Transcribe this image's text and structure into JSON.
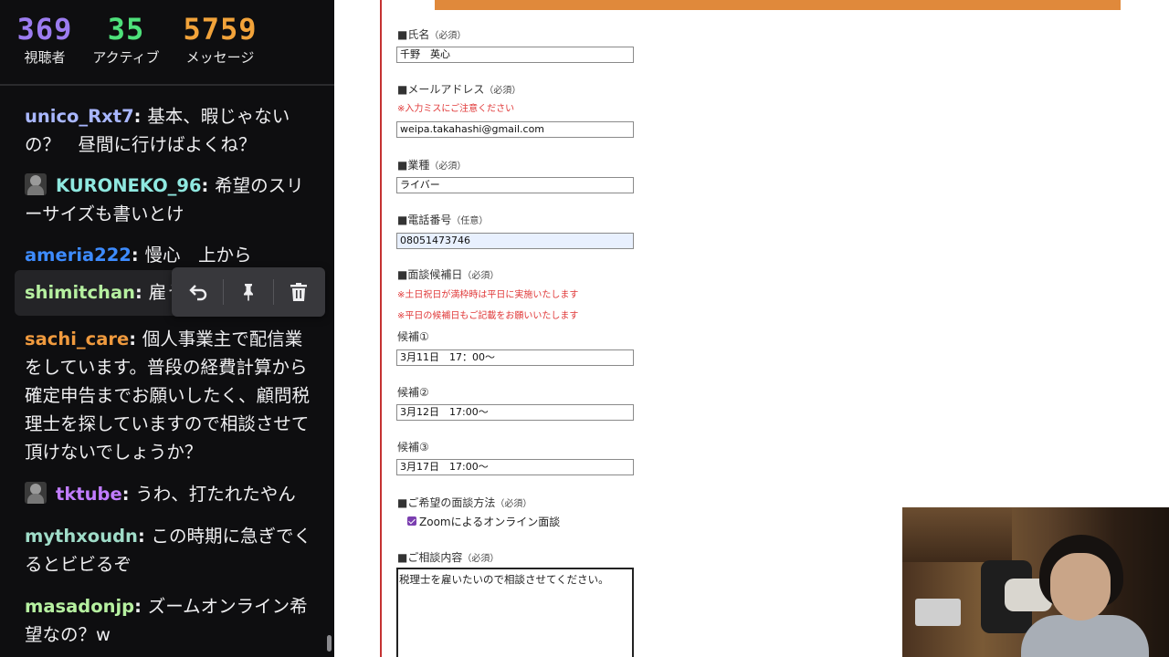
{
  "stats": {
    "viewers": {
      "value": "369",
      "label": "視聴者",
      "color": "#9c7cf0"
    },
    "active": {
      "value": "35",
      "label": "アクティブ",
      "color": "#4ee07a"
    },
    "messages": {
      "value": "5759",
      "label": "メッセージ",
      "color": "#f2a33a"
    }
  },
  "chat": {
    "messages": [
      {
        "user": "unico_Rxt7",
        "text": "基本、暇じゃないの？　昼間に行けばよくね？",
        "color": "#a9b7ff",
        "avatar": false
      },
      {
        "user": "KURONEKO_96",
        "text": "希望のスリーサイズも書いとけ",
        "color": "#8fe8e0",
        "avatar": true
      },
      {
        "user": "ameria222",
        "text": "慢心　上から",
        "color": "#3d8bff",
        "avatar": false
      },
      {
        "user": "shimitchan",
        "text": "雇うの",
        "color": "#b6f0a0",
        "avatar": false
      },
      {
        "user": "sachi_care",
        "text": "個人事業主で配信業をしています。普段の経費計算から確定申告までお願いしたく、顧問税理士を探していますので相談させて頂けないでしょうか？",
        "color": "#f09a3e",
        "avatar": false
      },
      {
        "user": "tktube",
        "text": "うわ、打たれたやん",
        "color": "#c17cff",
        "avatar": true
      },
      {
        "user": "mythxoudn",
        "text": "この時期に急ぎでくるとビビるぞ",
        "color": "#9fdcc8",
        "avatar": false
      },
      {
        "user": "masadonjp",
        "text": "ズームオンライン希望なの？w",
        "color": "#b6f0a0",
        "avatar": false
      }
    ],
    "toolbar_icons": [
      "reply-icon",
      "pin-icon",
      "trash-icon"
    ]
  },
  "form": {
    "name": {
      "label": "■氏名",
      "req": "（必須）",
      "value": "千野　英心"
    },
    "email": {
      "label": "■メールアドレス",
      "req": "（必須）",
      "note": "※入力ミスにご注意ください",
      "value": "weipa.takahashi@gmail.com"
    },
    "industry": {
      "label": "■業種",
      "req": "（必須）",
      "value": "ライバー"
    },
    "phone": {
      "label": "■電話番号",
      "req": "（任意）",
      "value": "08051473746"
    },
    "interview": {
      "label": "■面談候補日",
      "req": "（必須）",
      "notes": [
        "※土日祝日が満枠時は平日に実施いたします",
        "※平日の候補日もご記載をお願いいたします"
      ],
      "candidates": [
        {
          "label": "候補①",
          "value": "3月11日　17：00～"
        },
        {
          "label": "候補②",
          "value": "3月12日　17:00～"
        },
        {
          "label": "候補③",
          "value": "3月17日　17:00～"
        }
      ]
    },
    "method": {
      "label": "■ご希望の面談方法",
      "req": "（必須）",
      "option": "Zoomによるオンライン面談",
      "checked": true
    },
    "consult": {
      "label": "■ご相談内容",
      "req": "（必須）",
      "value": "税理士を雇いたいので相談させてください。"
    }
  },
  "colors": {
    "accent_orange": "#e0893b",
    "rule_red": "#c43232",
    "note_red": "#e03838",
    "chat_bg": "#0e0e10"
  }
}
